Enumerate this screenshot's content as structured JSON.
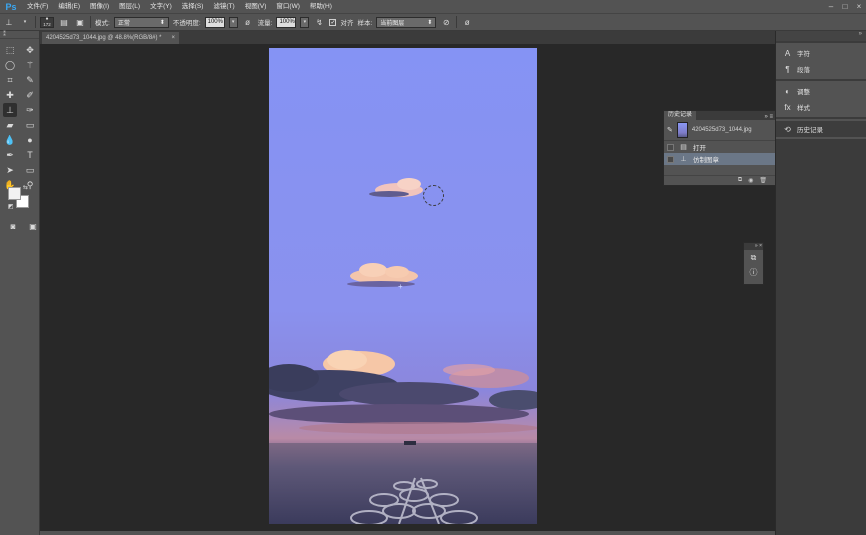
{
  "app": {
    "logo": "Ps"
  },
  "menu": [
    "文件(F)",
    "编辑(E)",
    "图像(I)",
    "图层(L)",
    "文字(Y)",
    "选择(S)",
    "滤镜(T)",
    "视图(V)",
    "窗口(W)",
    "帮助(H)"
  ],
  "window_controls": [
    "–",
    "□",
    "×"
  ],
  "options": {
    "brush_size": "172",
    "mode_label": "模式:",
    "mode_value": "正常",
    "opacity_label": "不透明度:",
    "opacity_value": "100%",
    "flow_label": "流量:",
    "flow_value": "100%",
    "aligned_label": "对齐",
    "sample_label": "样本:",
    "sample_value": "当前图层"
  },
  "document": {
    "tab_title": "4204525d73_1044.jpg @ 48.8%(RGB/8#) *",
    "tab_close": "×"
  },
  "history": {
    "tab_label": "历史记录",
    "snapshot_name": "4204525d73_1044.jpg",
    "steps": [
      {
        "label": "打开",
        "selected": false
      },
      {
        "label": "仿制图章",
        "selected": true
      }
    ]
  },
  "dock": {
    "group1": [
      {
        "label": "字符",
        "icon": "character-icon"
      },
      {
        "label": "段落",
        "icon": "paragraph-icon"
      }
    ],
    "group2": [
      {
        "label": "调整",
        "icon": "adjustments-icon"
      },
      {
        "label": "样式",
        "icon": "styles-icon"
      }
    ],
    "group3": [
      {
        "label": "历史记录",
        "icon": "history-icon"
      }
    ]
  },
  "colors": {
    "sky_top": "#8593f3",
    "sky_bottom": "#8682e0",
    "cloud": "#f4c5b7",
    "sea": "#5a5a85",
    "ui_dark": "#282828",
    "ui_panel": "#535353",
    "ps_blue": "#3aa8f4"
  }
}
